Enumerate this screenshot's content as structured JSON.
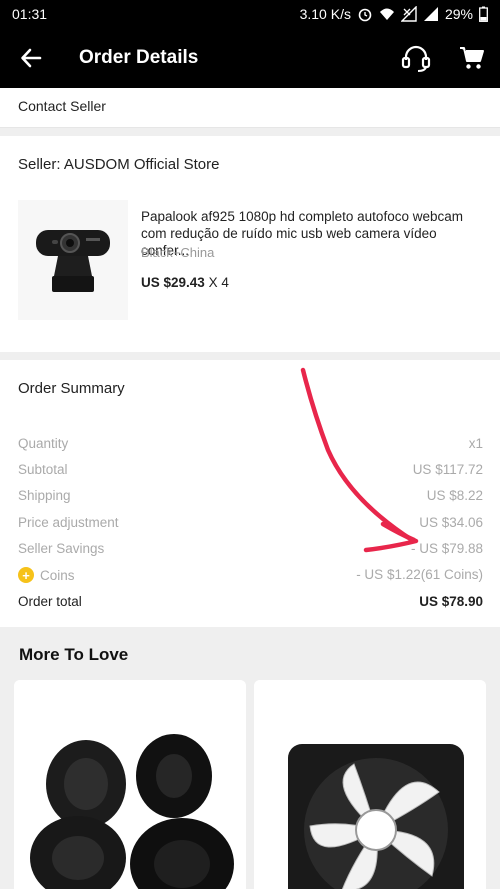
{
  "status_bar": {
    "time": "01:31",
    "speed": "3.10 K/s",
    "battery": "29%"
  },
  "app_bar": {
    "title": "Order Details",
    "back_icon": "arrow-left-icon",
    "support_icon": "headset-icon",
    "cart_icon": "cart-icon"
  },
  "contact": {
    "label": "Contact Seller"
  },
  "seller": {
    "label": "Seller: AUSDOM Official Store",
    "product": {
      "title": "Papalook af925 1080p hd completo autofoco webcam com redução de ruído mic usb web camera vídeo confer...",
      "variant": "Black+China",
      "price": "US $29.43",
      "qty": "X 4",
      "image": "webcam-image"
    }
  },
  "summary": {
    "heading": "Order Summary",
    "rows": [
      {
        "label": "Quantity",
        "value": "x1"
      },
      {
        "label": "Subtotal",
        "value": "US $117.72"
      },
      {
        "label": "Shipping",
        "value": "US $8.22"
      },
      {
        "label": "Price adjustment",
        "value": "US $34.06"
      },
      {
        "label": "Seller Savings",
        "value": "- US $79.88"
      },
      {
        "label": "Coins",
        "value": "- US $1.22(61 Coins)"
      }
    ],
    "total": {
      "label": "Order total",
      "value": "US $78.90"
    },
    "coin_color": "#f6c21a"
  },
  "more": {
    "heading": "More To Love",
    "items": [
      {
        "image": "ear-pads-image"
      },
      {
        "image": "cooling-fan-image"
      }
    ]
  },
  "annotation": {
    "color": "#e8264b",
    "shape": "hand-drawn-arrow"
  }
}
